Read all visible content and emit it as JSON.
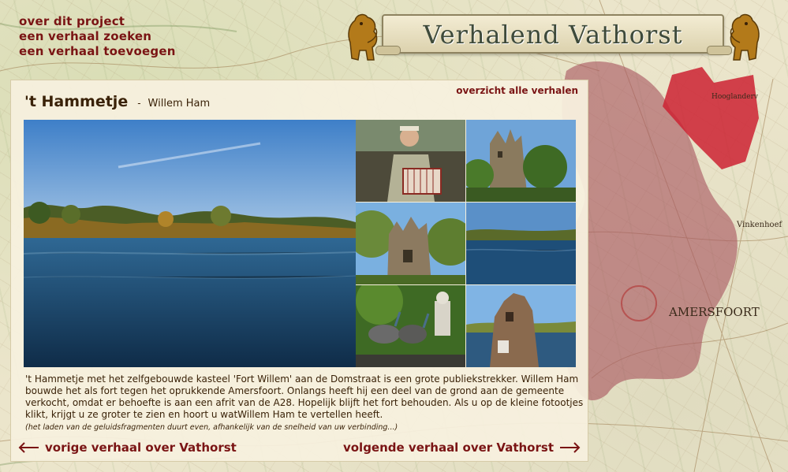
{
  "nav": {
    "items": [
      "over dit project",
      "een verhaal zoeken",
      "een verhaal toevoegen"
    ]
  },
  "banner": {
    "title": "Verhalend Vathorst"
  },
  "map": {
    "labels": [
      "Hooglanderv",
      "Vinkenhoef",
      "AMERSFOORT"
    ]
  },
  "story": {
    "title": "'t Hammetje",
    "separator": "-",
    "author": "Willem Ham",
    "overview_link": "overzicht alle verhalen",
    "description": "'t Hammetje met het zelfgebouwde kasteel 'Fort Willem' aan de Domstraat is een grote publiekstrekker. Willem Ham bouwde het als fort tegen het oprukkende Amersfoort. Onlangs heeft hij een deel van de grond aan de gemeente verkocht, omdat er behoefte is aan een afrit van de A28. Hopelijk blijft het fort behouden. Als u op de kleine fotootjes klikt, krijgt u ze groter te zien en hoort u watWillem Ham te vertellen heeft.",
    "note": "(het laden van de geluidsfragmenten duurt even, afhankelijk van de snelheid van uw verbinding...)",
    "thumbs": [
      "accordion-player",
      "castle-garden",
      "castle-tower",
      "lake-view",
      "peacocks-statue",
      "stone-ruin"
    ]
  },
  "pager": {
    "prev": "vorige verhaal over Vathorst",
    "next": "volgende verhaal over Vathorst"
  },
  "colors": {
    "accent": "#7a1414",
    "text": "#3a2208",
    "overlay": "#a8555f",
    "highlight": "#cc2233"
  }
}
